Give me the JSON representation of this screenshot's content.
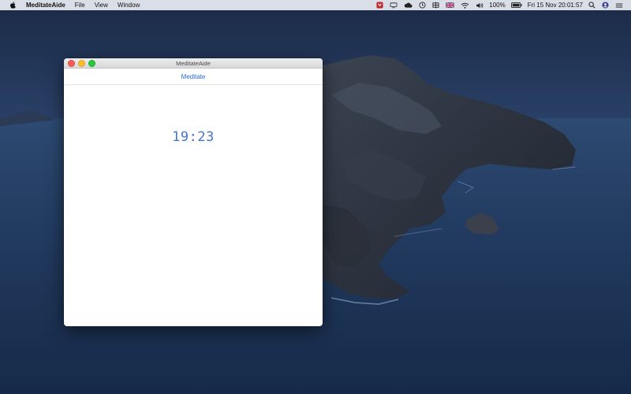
{
  "menubar": {
    "apple_icon": "apple-logo-icon",
    "app_name": "MeditateAide",
    "menus": [
      "File",
      "View",
      "Window"
    ],
    "status": {
      "battery_percent": "100%",
      "datetime": "Fri 15 Nov  20:01:57",
      "icons": [
        "shield-app-icon",
        "display-icon",
        "cloud-icon",
        "time-machine-icon",
        "vpn-icon",
        "uk-flag-icon",
        "wifi-icon",
        "volume-icon",
        "battery-icon",
        "spotlight-search-icon",
        "user-avatar-icon",
        "control-center-icon"
      ]
    }
  },
  "window": {
    "title": "MeditateAide",
    "tab_label": "Meditate",
    "timer": "19:23"
  },
  "colors": {
    "accent": "#2a6ad8",
    "timer": "#4672cf"
  }
}
